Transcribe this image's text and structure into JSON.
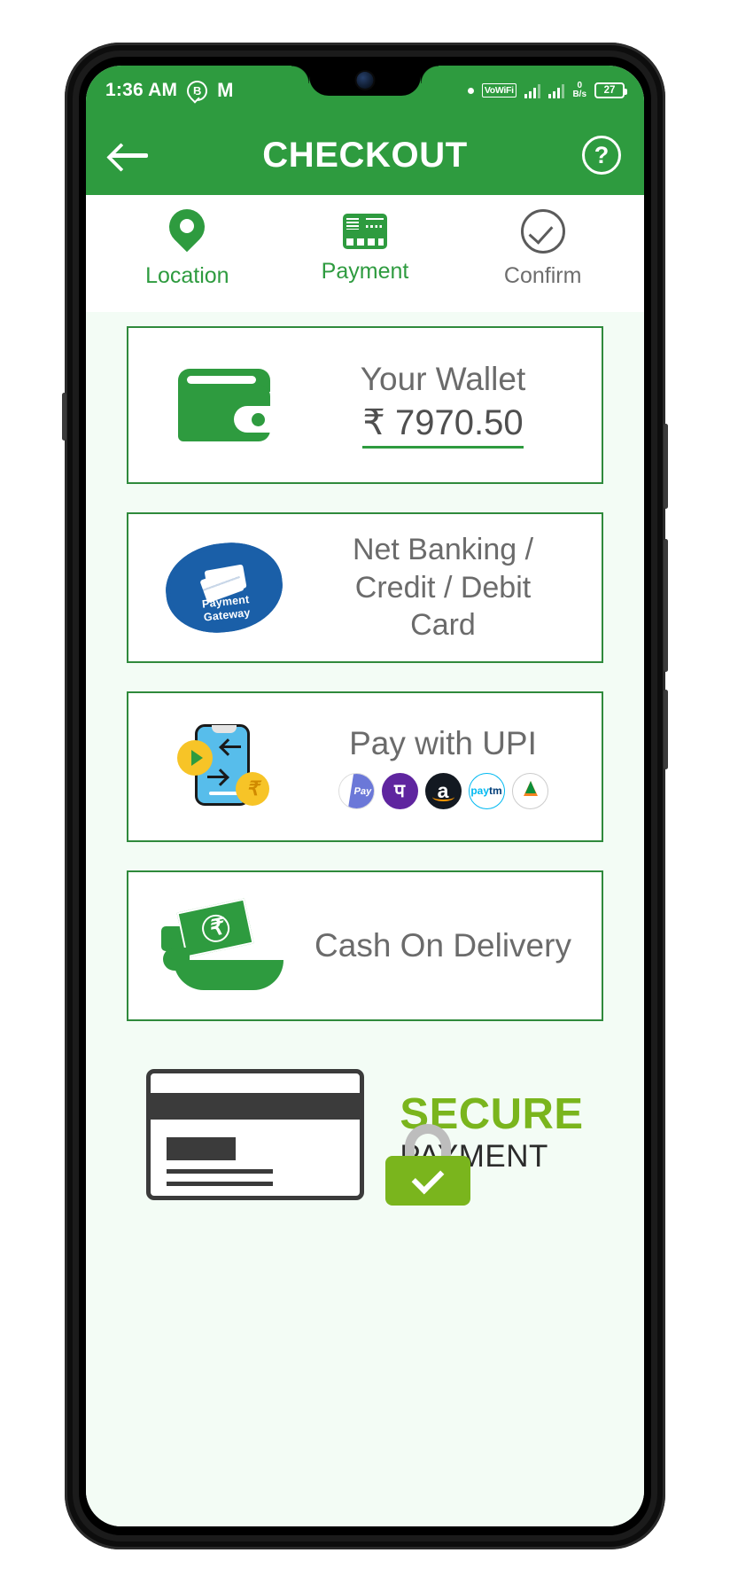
{
  "status_bar": {
    "time": "1:36 AM",
    "icons": [
      "whatsapp-business-icon",
      "gmail-icon",
      "dot-indicator"
    ],
    "vowifi_label": "VoWiFi",
    "net_speed_value": "0",
    "net_speed_unit": "B/s",
    "battery_level": "27"
  },
  "app_bar": {
    "title": "CHECKOUT",
    "back_label": "Back",
    "help_label": "?"
  },
  "stepper": {
    "steps": [
      {
        "label": "Location",
        "icon": "location-pin-icon",
        "state": "active"
      },
      {
        "label": "Payment",
        "icon": "payment-card-icon",
        "state": "active"
      },
      {
        "label": "Confirm",
        "icon": "check-circle-icon",
        "state": "inactive"
      }
    ]
  },
  "payment_options": [
    {
      "id": "wallet",
      "icon": "wallet-icon",
      "title": "Your Wallet",
      "amount": "₹ 7970.50"
    },
    {
      "id": "netbanking",
      "icon": "payment-gateway-badge-icon",
      "badge_line1": "Payment",
      "badge_line2": "Gateway",
      "title_line1": "Net Banking /",
      "title_line2": "Credit / Debit",
      "title_line3": "Card"
    },
    {
      "id": "upi",
      "icon": "upi-phone-icon",
      "title": "Pay with UPI",
      "providers": [
        {
          "name": "google-pay-logo",
          "text_g": "G",
          "text_pay": "Pay"
        },
        {
          "name": "phonepe-logo",
          "glyph": "प"
        },
        {
          "name": "amazon-pay-logo",
          "glyph": "a"
        },
        {
          "name": "paytm-logo",
          "glyph_a": "pay",
          "glyph_b": "tm"
        },
        {
          "name": "bhim-upi-logo",
          "glyph": ""
        }
      ]
    },
    {
      "id": "cod",
      "icon": "cash-hand-icon",
      "title": "Cash On Delivery"
    }
  ],
  "footer": {
    "icon": "secure-card-lock-icon",
    "line1": "SECURE",
    "line2": "PAYMENT"
  },
  "colors": {
    "brand_green": "#2e9b3f",
    "card_border": "#2f8a3c",
    "page_bg": "#f3fcf5",
    "text_gray": "#6b6b6b",
    "secure_green": "#7ab51d",
    "gateway_blue": "#1a5fa8"
  }
}
